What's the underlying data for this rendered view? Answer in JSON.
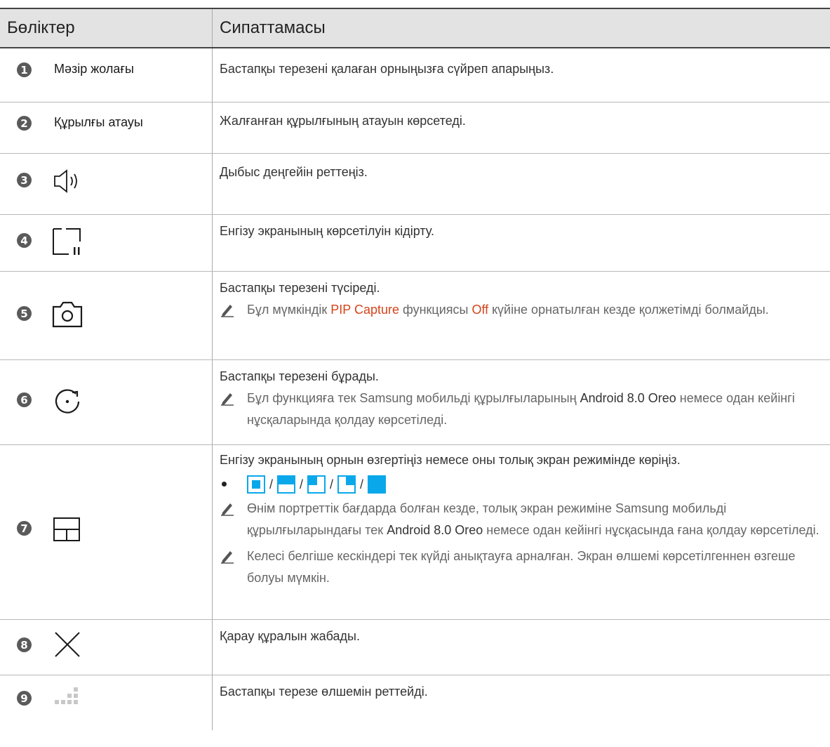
{
  "header": {
    "col_parts": "Бөліктер",
    "col_desc": "Сипаттамасы"
  },
  "rows": [
    {
      "num": "1",
      "part": "Мәзір жолағы",
      "desc": "Бастапқы терезені қалаған орныңызға сүйреп апарыңыз."
    },
    {
      "num": "2",
      "part": "Құрылғы атауы",
      "desc": "Жалғанған құрылғының атауын көрсетеді."
    },
    {
      "num": "3",
      "icon": "volume-icon",
      "desc": "Дыбыс деңгейін реттеңіз."
    },
    {
      "num": "4",
      "icon": "pause-screen-icon",
      "desc": "Енгізу экранының көрсетілуін кідірту."
    },
    {
      "num": "5",
      "icon": "camera-icon",
      "desc": "Бастапқы терезені түсіреді.",
      "note": {
        "pre": "Бұл мүмкіндік ",
        "em1": "PIP Capture",
        "mid": " функциясы ",
        "em2": "Off",
        "post": " күйіне орнатылған кезде қолжетімді болмайды."
      }
    },
    {
      "num": "6",
      "icon": "rotate-icon",
      "desc": "Бастапқы терезені бұрады.",
      "note": {
        "pre": "Бұл функцияға тек Samsung мобильді құрылғыларының ",
        "em1": "Android 8.0 Oreo",
        "post": " немесе одан кейінгі нұсқаларында қолдау көрсетіледі."
      }
    },
    {
      "num": "7",
      "icon": "layout-icon",
      "desc": "Енгізу экранының орнын өзгертіңіз немесе оны толық экран режимінде көріңіз.",
      "bullet_icons": [
        "position-center-icon",
        "position-top-icon",
        "position-top-left-icon",
        "position-top-right-icon",
        "position-full-icon"
      ],
      "separator": "/",
      "note1": {
        "pre": "Өнім портреттік бағдарда болған кезде, толық экран режиміне Samsung мобильді құрылғыларындағы тек ",
        "em1": "Android 8.0 Oreo",
        "post": " немесе одан кейінгі нұсқасында ғана қолдау көрсетіледі."
      },
      "note2": "Келесі белгіше кескіндері тек күйді анықтауға арналған. Экран өлшемі көрсетілгеннен өзгеше болуы мүмкін."
    },
    {
      "num": "8",
      "icon": "close-icon",
      "desc": "Қарау құралын жабады."
    },
    {
      "num": "9",
      "icon": "resize-handle-icon",
      "desc": "Бастапқы терезе өлшемін реттейді."
    }
  ],
  "colors": {
    "accent_blue": "#0aa8ea",
    "emphasis_red": "#d5441c",
    "header_bg": "#e3e3e3",
    "number_badge": "#5a5a5a"
  }
}
